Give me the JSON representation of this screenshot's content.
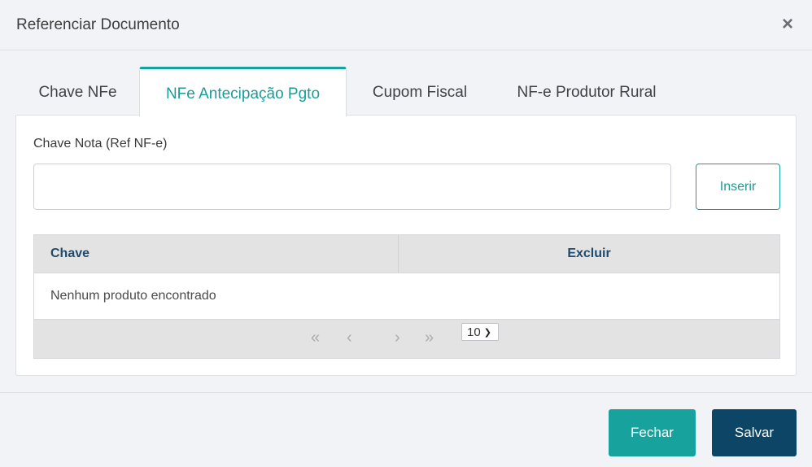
{
  "modal": {
    "title": "Referenciar Documento",
    "close_icon": "×"
  },
  "tabs": [
    {
      "label": "Chave NFe",
      "active": false
    },
    {
      "label": "NFe Antecipação Pgto",
      "active": true
    },
    {
      "label": "Cupom Fiscal",
      "active": false
    },
    {
      "label": "NF-e Produtor Rural",
      "active": false
    }
  ],
  "form": {
    "field_label": "Chave Nota (Ref NF-e)",
    "field_value": "",
    "insert_label": "Inserir"
  },
  "grid": {
    "columns": [
      "Chave",
      "Excluir"
    ],
    "empty_message": "Nenhum produto encontrado",
    "pager": {
      "first_icon": "«",
      "prev_icon": "‹",
      "next_icon": "›",
      "last_icon": "»",
      "page_size": "10"
    }
  },
  "footer": {
    "close_label": "Fechar",
    "save_label": "Salvar"
  },
  "colors": {
    "accent": "#17a29d",
    "primary_dark": "#0c4566",
    "header_text": "#1f4a6b"
  }
}
